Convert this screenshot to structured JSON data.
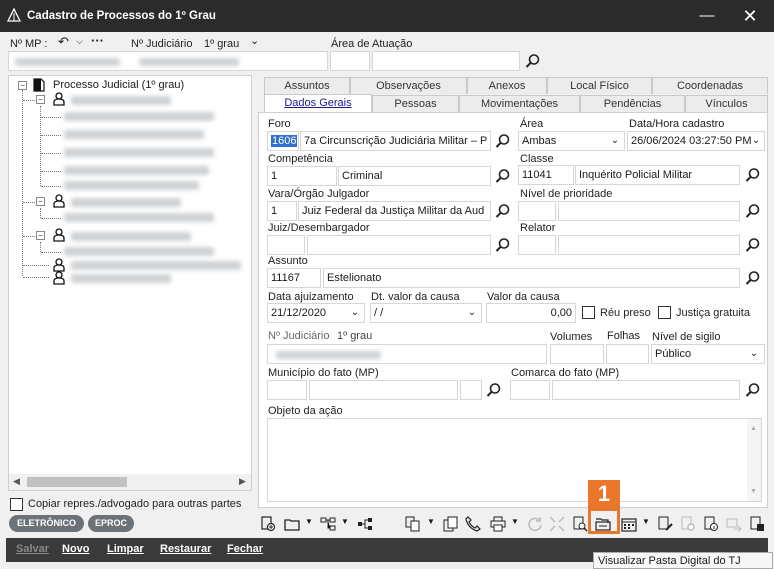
{
  "window": {
    "title": "Cadastro de Processos do 1º Grau"
  },
  "topbar": {
    "mp_label": "Nº MP :",
    "judiciario_label": "Nº Judiciário",
    "grau_label": "1º grau",
    "area_atuacao_label": "Área de Atuação"
  },
  "tree": {
    "root": "Processo Judicial (1º grau)"
  },
  "tabs_row1": [
    "Assuntos",
    "Observações",
    "Anexos",
    "Local Físico",
    "Coordenadas"
  ],
  "tabs_row2": [
    "Dados Gerais",
    "Pessoas",
    "Movimentações",
    "Pendências",
    "Vínculos"
  ],
  "form": {
    "foro_label": "Foro",
    "foro_code": "1606",
    "foro_name": "7a Circunscrição Judiciária Militar – P",
    "area_label": "Área",
    "area_value": "Ambas",
    "data_cadastro_label": "Data/Hora cadastro",
    "data_cadastro_value": "26/06/2024 03:27:50 PM",
    "competencia_label": "Competência",
    "competencia_code": "1",
    "competencia_name": "Criminal",
    "classe_label": "Classe",
    "classe_code": "11041",
    "classe_name": "Inquérito Policial Militar",
    "vara_label": "Vara/Órgão Julgador",
    "vara_code": "1",
    "vara_name": "Juiz Federal da Justiça Militar da Aud",
    "nivel_prioridade_label": "Nível de prioridade",
    "juiz_label": "Juiz/Desembargador",
    "relator_label": "Relator",
    "assunto_label": "Assunto",
    "assunto_code": "11167",
    "assunto_name": "Estelionato",
    "data_ajuizamento_label": "Data ajuizamento",
    "data_ajuizamento_value": "21/12/2020",
    "dt_valor_causa_label": "Dt. valor da causa",
    "dt_valor_causa_value": " / /",
    "valor_causa_label": "Valor da causa",
    "valor_causa_value": "0,00",
    "reu_preso_label": "Réu preso",
    "justica_gratuita_label": "Justiça gratuita",
    "num_judiciario_label": "Nº Judiciário",
    "grau_label": "1º grau",
    "volumes_label": "Volumes",
    "folhas_label": "Folhas",
    "nivel_sigilo_label": "Nível de sigilo",
    "nivel_sigilo_value": "Público",
    "municipio_label": "Município do fato (MP)",
    "comarca_label": "Comarca do fato (MP)",
    "objeto_label": "Objeto da ação"
  },
  "left_footer": {
    "copiar_label": "Copiar repres./advogado para outras partes",
    "eletronico_label": "ELETRÔNICO",
    "eproc_label": "EPROC"
  },
  "bottom_buttons": {
    "salvar": "Salvar",
    "novo": "Novo",
    "limpar": "Limpar",
    "restaurar": "Restaurar",
    "fechar": "Fechar"
  },
  "annotation": {
    "badge": "1"
  },
  "tooltip": {
    "text": "Visualizar Pasta Digital do TJ"
  },
  "colors": {
    "titlebar": "#2b2b2b",
    "accent": "#e8772b",
    "pill": "#6d7278"
  }
}
